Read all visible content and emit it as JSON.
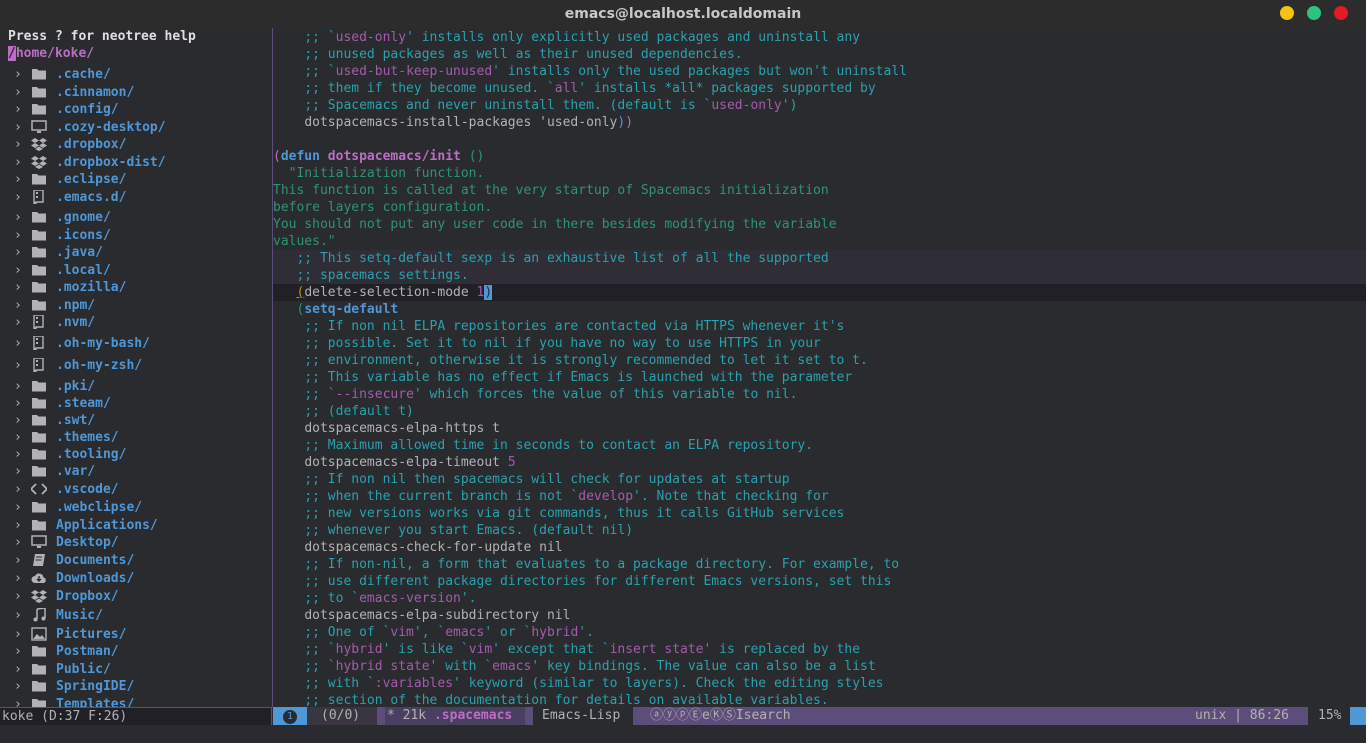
{
  "window": {
    "title": "emacs@localhost.localdomain"
  },
  "neotree": {
    "help": "Press ? for neotree help",
    "root_cursor": "/",
    "root_rest": "home/koke/",
    "items": [
      {
        "label": ".cache/",
        "icon": "folder-icon"
      },
      {
        "label": ".cinnamon/",
        "icon": "folder-icon"
      },
      {
        "label": ".config/",
        "icon": "folder-icon"
      },
      {
        "label": ".cozy-desktop/",
        "icon": "desktop-icon"
      },
      {
        "label": ".dropbox/",
        "icon": "dropbox-icon"
      },
      {
        "label": ".dropbox-dist/",
        "icon": "dropbox-icon"
      },
      {
        "label": ".eclipse/",
        "icon": "folder-icon"
      },
      {
        "label": ".emacs.d/",
        "icon": "repo-icon"
      },
      {
        "label": ".gnome/",
        "icon": "folder-icon"
      },
      {
        "label": ".icons/",
        "icon": "folder-icon"
      },
      {
        "label": ".java/",
        "icon": "folder-icon"
      },
      {
        "label": ".local/",
        "icon": "folder-icon"
      },
      {
        "label": ".mozilla/",
        "icon": "folder-icon"
      },
      {
        "label": ".npm/",
        "icon": "folder-icon"
      },
      {
        "label": ".nvm/",
        "icon": "repo-icon"
      },
      {
        "label": ".oh-my-bash/",
        "icon": "repo-icon"
      },
      {
        "label": ".oh-my-zsh/",
        "icon": "repo-icon"
      },
      {
        "label": ".pki/",
        "icon": "folder-icon"
      },
      {
        "label": ".steam/",
        "icon": "folder-icon"
      },
      {
        "label": ".swt/",
        "icon": "folder-icon"
      },
      {
        "label": ".themes/",
        "icon": "folder-icon"
      },
      {
        "label": ".tooling/",
        "icon": "folder-icon"
      },
      {
        "label": ".var/",
        "icon": "folder-icon"
      },
      {
        "label": ".vscode/",
        "icon": "code-icon"
      },
      {
        "label": ".webclipse/",
        "icon": "folder-icon"
      },
      {
        "label": "Applications/",
        "icon": "folder-icon"
      },
      {
        "label": "Desktop/",
        "icon": "desktop-icon"
      },
      {
        "label": "Documents/",
        "icon": "book-icon"
      },
      {
        "label": "Downloads/",
        "icon": "cloud-download-icon"
      },
      {
        "label": "Dropbox/",
        "icon": "dropbox-icon"
      },
      {
        "label": "Music/",
        "icon": "music-icon"
      },
      {
        "label": "Pictures/",
        "icon": "picture-icon"
      },
      {
        "label": "Postman/",
        "icon": "folder-icon"
      },
      {
        "label": "Public/",
        "icon": "folder-icon"
      },
      {
        "label": "SpringIDE/",
        "icon": "folder-icon"
      },
      {
        "label": "Templates/",
        "icon": "folder-icon"
      }
    ],
    "modeline": "koke (D:37 F:26)"
  },
  "editor": {
    "lines": [
      {
        "indent": "    ",
        "text": ";; `used-only' installs only explicitly used packages and uninstall any",
        "kind": "comment"
      },
      {
        "indent": "    ",
        "text": ";; unused packages as well as their unused dependencies.",
        "kind": "comment"
      },
      {
        "indent": "    ",
        "text": ";; `used-but-keep-unused' installs only the used packages but won't uninstall",
        "kind": "comment"
      },
      {
        "indent": "    ",
        "text": ";; them if they become unused. `all' installs *all* packages supported by",
        "kind": "comment"
      },
      {
        "indent": "    ",
        "text": ";; Spacemacs and never uninstall them. (default is `used-only')",
        "kind": "comment"
      },
      {
        "indent": "    ",
        "text": "dotspacemacs-install-packages 'used-only))",
        "kind": "plain"
      },
      {
        "indent": "",
        "text": "",
        "kind": "plain"
      },
      {
        "indent": "",
        "text": "(defun dotspacemacs/init ()",
        "kind": "defun"
      },
      {
        "indent": "  ",
        "text": "\"Initialization function.",
        "kind": "string"
      },
      {
        "indent": "",
        "text": "This function is called at the very startup of Spacemacs initialization",
        "kind": "string"
      },
      {
        "indent": "",
        "text": "before layers configuration.",
        "kind": "string"
      },
      {
        "indent": "",
        "text": "You should not put any user code in there besides modifying the variable",
        "kind": "string"
      },
      {
        "indent": "",
        "text": "values.\"",
        "kind": "string"
      },
      {
        "indent": "   ",
        "text": ";; This setq-default sexp is an exhaustive list of all the supported",
        "kind": "comment"
      },
      {
        "indent": "   ",
        "text": ";; spacemacs settings.",
        "kind": "comment"
      },
      {
        "indent": "   ",
        "text": "(delete-selection-mode 1)",
        "kind": "current"
      },
      {
        "indent": "   ",
        "text": "(setq-default",
        "kind": "setq"
      },
      {
        "indent": "    ",
        "text": ";; If non nil ELPA repositories are contacted via HTTPS whenever it's",
        "kind": "comment"
      },
      {
        "indent": "    ",
        "text": ";; possible. Set it to nil if you have no way to use HTTPS in your",
        "kind": "comment"
      },
      {
        "indent": "    ",
        "text": ";; environment, otherwise it is strongly recommended to let it set to t.",
        "kind": "comment"
      },
      {
        "indent": "    ",
        "text": ";; This variable has no effect if Emacs is launched with the parameter",
        "kind": "comment"
      },
      {
        "indent": "    ",
        "text": ";; `--insecure' which forces the value of this variable to nil.",
        "kind": "comment"
      },
      {
        "indent": "    ",
        "text": ";; (default t)",
        "kind": "comment"
      },
      {
        "indent": "    ",
        "text": "dotspacemacs-elpa-https t",
        "kind": "plain"
      },
      {
        "indent": "    ",
        "text": ";; Maximum allowed time in seconds to contact an ELPA repository.",
        "kind": "comment"
      },
      {
        "indent": "    ",
        "text": "dotspacemacs-elpa-timeout 5",
        "kind": "num"
      },
      {
        "indent": "    ",
        "text": ";; If non nil then spacemacs will check for updates at startup",
        "kind": "comment"
      },
      {
        "indent": "    ",
        "text": ";; when the current branch is not `develop'. Note that checking for",
        "kind": "comment"
      },
      {
        "indent": "    ",
        "text": ";; new versions works via git commands, thus it calls GitHub services",
        "kind": "comment"
      },
      {
        "indent": "    ",
        "text": ";; whenever you start Emacs. (default nil)",
        "kind": "comment"
      },
      {
        "indent": "    ",
        "text": "dotspacemacs-check-for-update nil",
        "kind": "plain"
      },
      {
        "indent": "    ",
        "text": ";; If non-nil, a form that evaluates to a package directory. For example, to",
        "kind": "comment"
      },
      {
        "indent": "    ",
        "text": ";; use different package directories for different Emacs versions, set this",
        "kind": "comment"
      },
      {
        "indent": "    ",
        "text": ";; to `emacs-version'.",
        "kind": "comment"
      },
      {
        "indent": "    ",
        "text": "dotspacemacs-elpa-subdirectory nil",
        "kind": "plain"
      },
      {
        "indent": "    ",
        "text": ";; One of `vim', `emacs' or `hybrid'.",
        "kind": "comment"
      },
      {
        "indent": "    ",
        "text": ";; `hybrid' is like `vim' except that `insert state' is replaced by the",
        "kind": "comment"
      },
      {
        "indent": "    ",
        "text": ";; `hybrid state' with `emacs' key bindings. The value can also be a list",
        "kind": "comment"
      },
      {
        "indent": "    ",
        "text": ";; with `:variables' keyword (similar to layers). Check the editing styles",
        "kind": "comment"
      },
      {
        "indent": "    ",
        "text": ";; section of the documentation for details on available variables.",
        "kind": "comment"
      }
    ]
  },
  "modeline": {
    "window_number": "1",
    "count": "(0/0)",
    "modified": "*",
    "size": "21k",
    "buffer": ".spacemacs",
    "major_mode": "Emacs-Lisp",
    "minor_modes": "ⓐⓨⓟⒺeⓀⓈIsearch",
    "encoding": "unix",
    "separator": "|",
    "position": "86:26",
    "percent": "15%"
  }
}
